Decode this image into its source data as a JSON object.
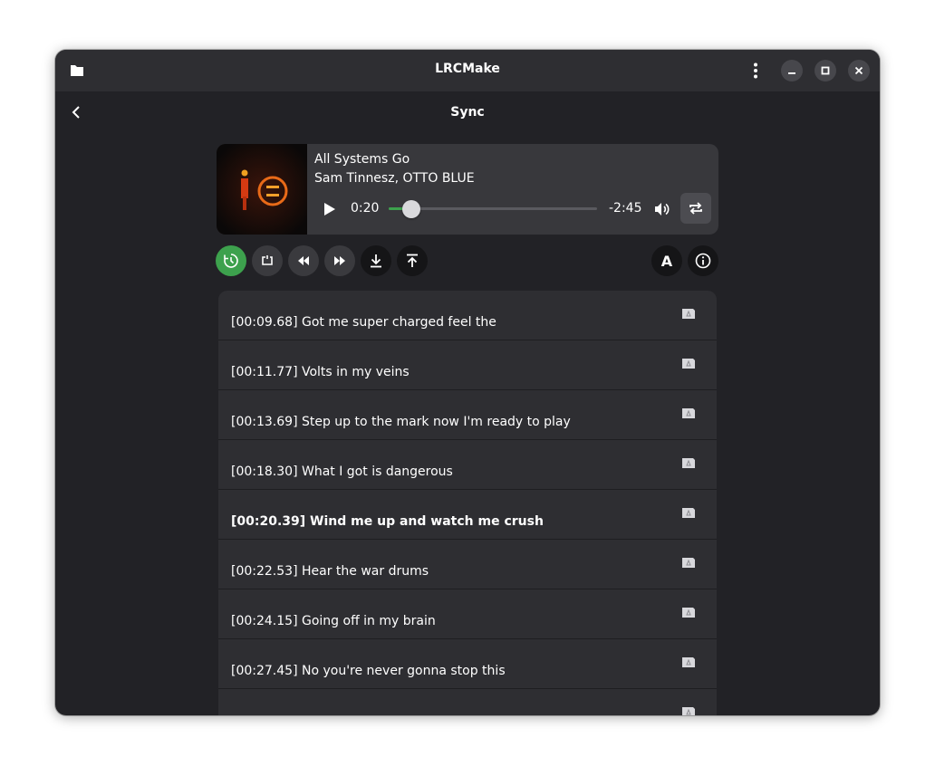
{
  "window": {
    "title": "LRCMake"
  },
  "page": {
    "title": "Sync"
  },
  "player": {
    "title": "All Systems Go",
    "artist": "Sam Tinnesz, OTTO BLUE",
    "current_time": "0:20",
    "remaining_time": "-2:45",
    "progress": 0.11
  },
  "toolbar": {
    "buttons": [
      {
        "name": "sync-mode-button",
        "icon": "clock-icon",
        "active": true
      },
      {
        "name": "loop-button",
        "icon": "loop-icon"
      },
      {
        "name": "seek-back-button",
        "icon": "rewind-icon"
      },
      {
        "name": "seek-forward-button",
        "icon": "fast-forward-icon"
      },
      {
        "name": "sync-line-button",
        "icon": "download-arrow-icon"
      },
      {
        "name": "remove-timestamp-button",
        "icon": "upload-arrow-icon"
      }
    ],
    "font_button_label": "A"
  },
  "colors": {
    "accent": "#3da14d",
    "window_bg": "#222226",
    "headerbar_bg": "#2e2e32",
    "card_bg": "#38383c"
  },
  "lyrics": [
    {
      "text": "[00:09.68] Got me super charged feel the",
      "active": false
    },
    {
      "text": "[00:11.77] Volts in my veins",
      "active": false
    },
    {
      "text": "[00:13.69] Step up to the mark now I'm ready to play",
      "active": false
    },
    {
      "text": "[00:18.30] What I got is dangerous",
      "active": false
    },
    {
      "text": "[00:20.39] Wind me up and watch me crush",
      "active": true
    },
    {
      "text": "[00:22.53] Hear the war drums",
      "active": false
    },
    {
      "text": "[00:24.15] Going off in my brain",
      "active": false
    },
    {
      "text": "[00:27.45] No you're never gonna stop this",
      "active": false
    },
    {
      "text": "",
      "active": false
    }
  ]
}
